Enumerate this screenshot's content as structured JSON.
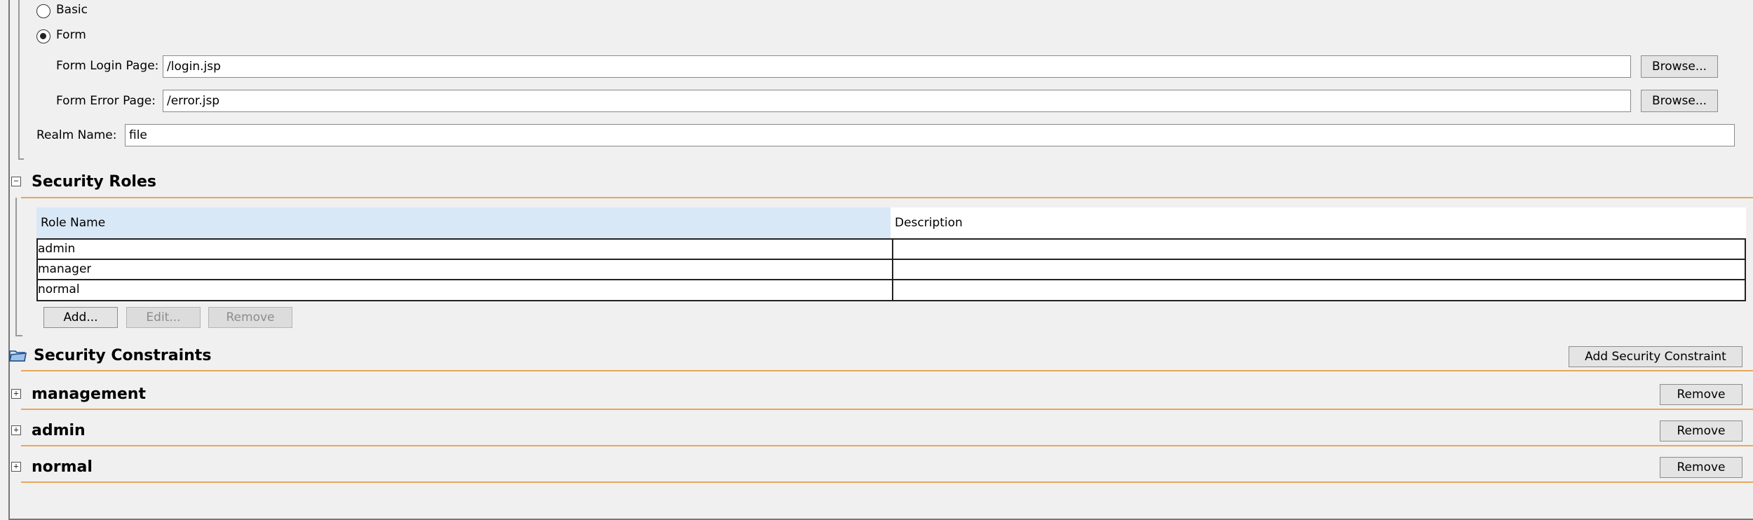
{
  "auth": {
    "basic_label": "Basic",
    "form_label": "Form",
    "selected": "Form",
    "login_page_label": "Form Login Page:",
    "login_page_value": "/login.jsp",
    "error_page_label": "Form Error Page:",
    "error_page_value": "/error.jsp",
    "browse_label": "Browse...",
    "realm_label": "Realm Name:",
    "realm_value": "file"
  },
  "security_roles": {
    "title": "Security Roles",
    "columns": [
      "Role Name",
      "Description"
    ],
    "rows": [
      {
        "name": "admin",
        "description": ""
      },
      {
        "name": "manager",
        "description": ""
      },
      {
        "name": "normal",
        "description": ""
      }
    ],
    "add_label": "Add...",
    "edit_label": "Edit...",
    "remove_label": "Remove"
  },
  "security_constraints": {
    "title": "Security Constraints",
    "add_constraint_label": "Add Security Constraint",
    "items": [
      {
        "name": "management",
        "remove_label": "Remove"
      },
      {
        "name": "admin",
        "remove_label": "Remove"
      },
      {
        "name": "normal",
        "remove_label": "Remove"
      }
    ]
  },
  "colors": {
    "section_rule": "#e8a75b",
    "header_selected": "#d9e8f6",
    "background": "#f0f0f0"
  },
  "icons": {
    "collapse": "minus-box-icon",
    "expand": "plus-box-icon",
    "constraints": "folder-icon"
  }
}
